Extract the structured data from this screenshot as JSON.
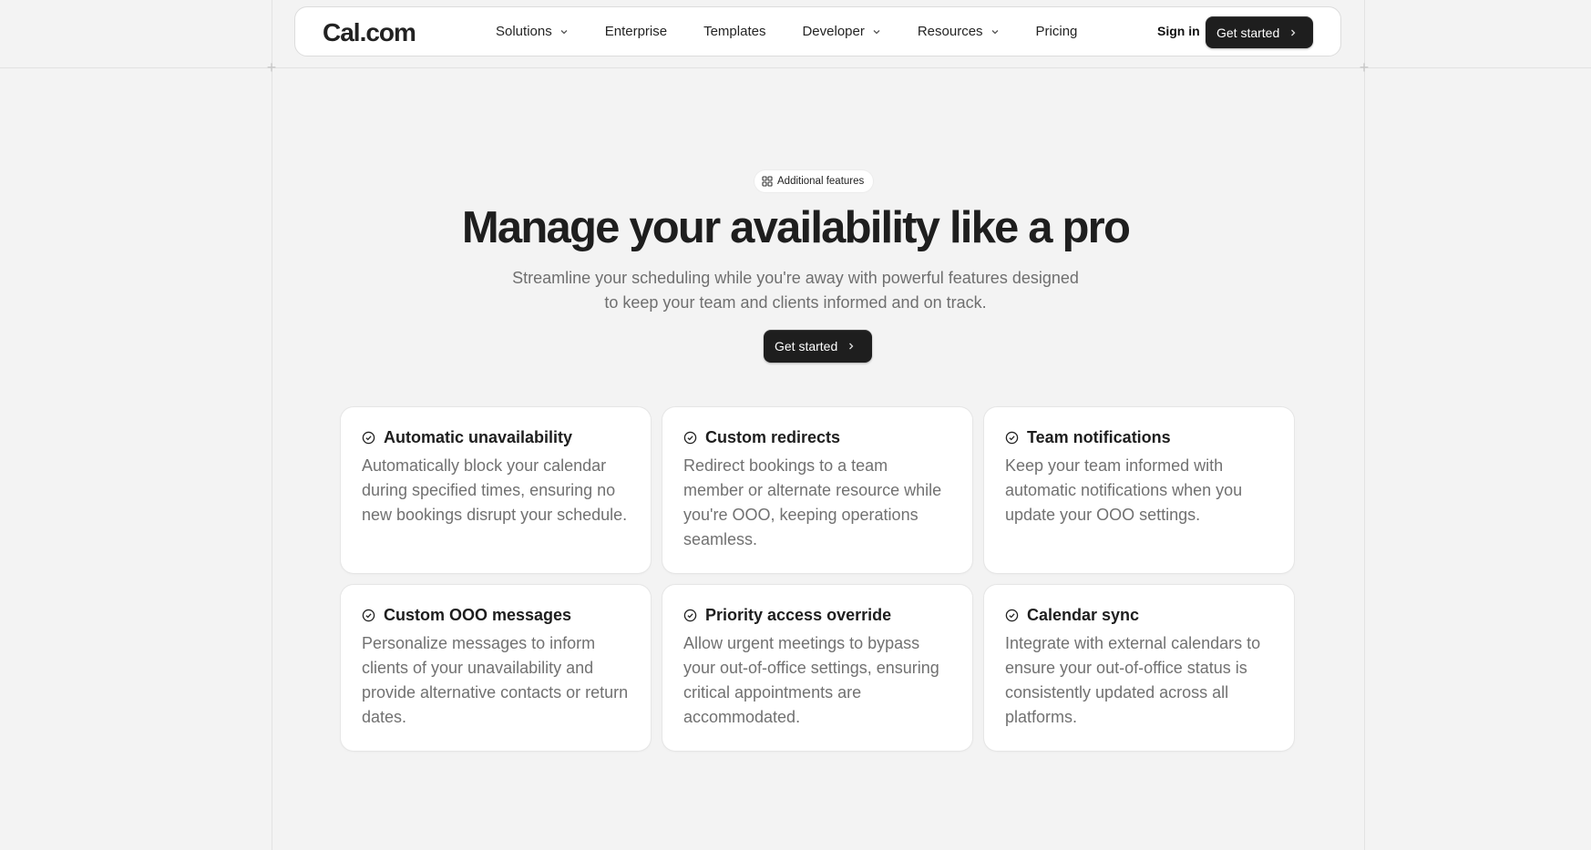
{
  "nav": {
    "logo": "Cal.com",
    "items": [
      {
        "label": "Solutions",
        "has_dropdown": true
      },
      {
        "label": "Enterprise",
        "has_dropdown": false
      },
      {
        "label": "Templates",
        "has_dropdown": false
      },
      {
        "label": "Developer",
        "has_dropdown": true
      },
      {
        "label": "Resources",
        "has_dropdown": true
      },
      {
        "label": "Pricing",
        "has_dropdown": false
      }
    ],
    "sign_in": "Sign in",
    "cta": "Get started"
  },
  "hero": {
    "badge": "Additional features",
    "title": "Manage your availability like a pro",
    "subtitle_line1": "Streamline your scheduling while you're away with powerful features designed",
    "subtitle_line2": "to keep your team and clients informed and on track.",
    "cta": "Get started"
  },
  "features": [
    {
      "title": "Automatic unavailability",
      "description": "Automatically block your calendar during specified times, ensuring no new bookings disrupt your schedule."
    },
    {
      "title": "Custom redirects",
      "description": "Redirect bookings to a team member or alternate resource while you're OOO, keeping operations seamless."
    },
    {
      "title": "Team notifications",
      "description": "Keep your team informed with automatic notifications when you update your OOO settings."
    },
    {
      "title": "Custom OOO messages",
      "description": "Personalize messages to inform clients of your unavailability and provide alternative contacts or return dates."
    },
    {
      "title": "Priority access override",
      "description": "Allow urgent meetings to bypass your out-of-office settings, ensuring critical appointments are accommodated."
    },
    {
      "title": "Calendar sync",
      "description": "Integrate with external calendars to ensure your out-of-office status is consistently updated across all platforms."
    }
  ],
  "icons": {
    "dropdown": "chevron-down-icon",
    "cta_arrow": "chevron-right-icon",
    "badge": "grid-icon",
    "feature": "check-circle-icon"
  },
  "colors": {
    "background": "#f3f3f3",
    "primary_button": "#1e1e1e",
    "text": "#1e1e1e",
    "muted_text": "#717171"
  }
}
